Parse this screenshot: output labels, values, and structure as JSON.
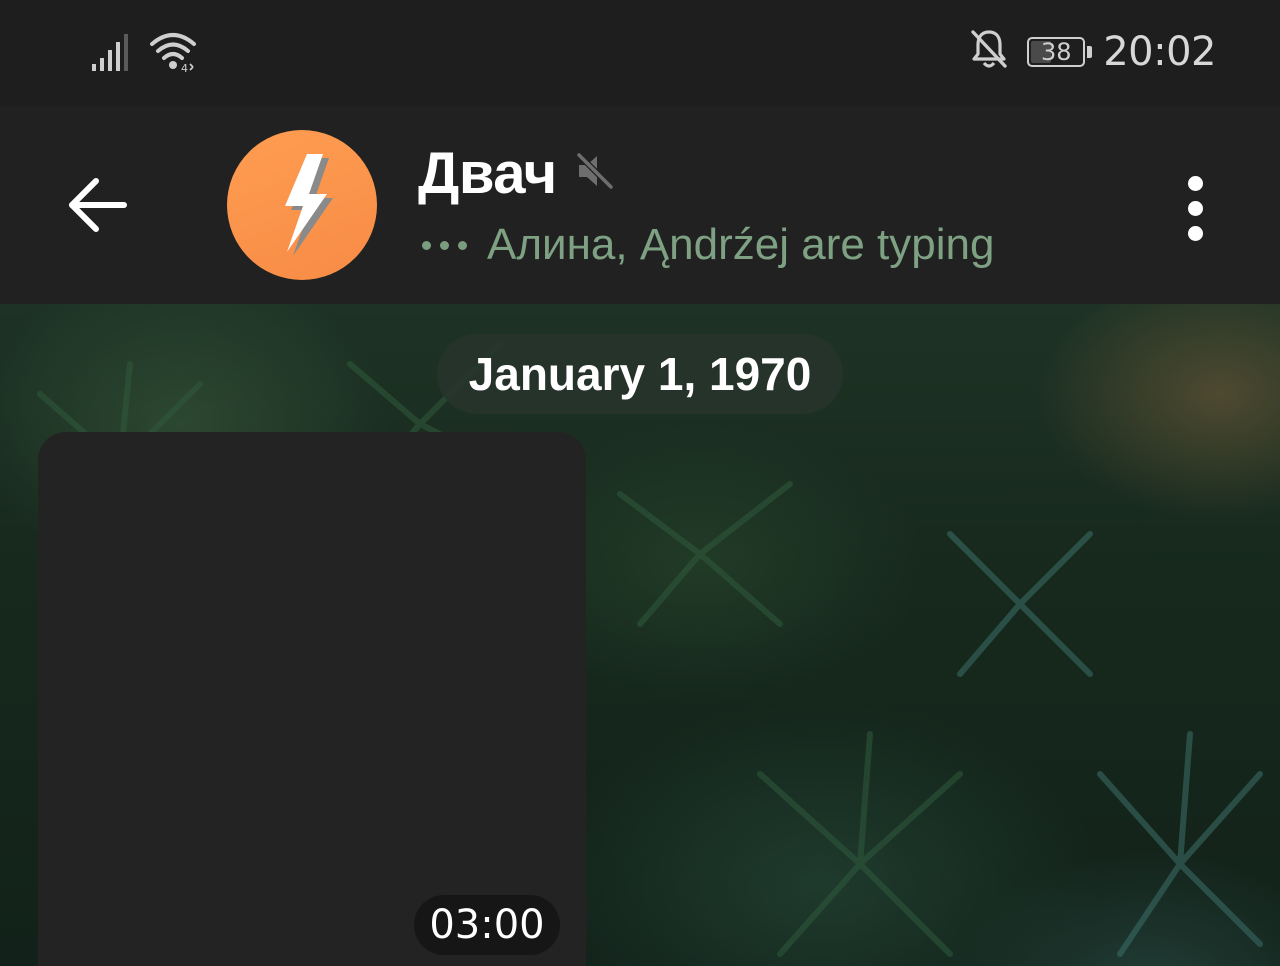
{
  "status_bar": {
    "signal_icon": "cellular-signal-icon",
    "wifi_icon": "wifi-icon",
    "mute_icon": "notifications-off-icon",
    "battery_level": "38",
    "time": "20:02"
  },
  "header": {
    "back_icon": "arrow-back-icon",
    "avatar_icon": "lightning-bolt-icon",
    "avatar_color": "#f78b45",
    "title": "Двач",
    "muted_icon": "muted-speaker-icon",
    "typing_status": "Алина, Ąndrźej are typing",
    "typing_color": "#7fa183",
    "more_icon": "more-vertical-icon"
  },
  "chat": {
    "date_separator": "January 1, 1970",
    "messages": [
      {
        "type": "video",
        "duration": "03:00"
      }
    ]
  }
}
